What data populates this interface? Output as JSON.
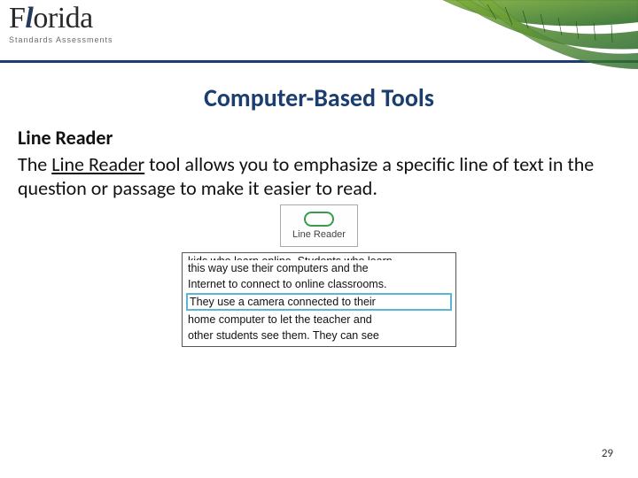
{
  "header": {
    "logo_main": "Florida",
    "logo_tagline": "Standards Assessments"
  },
  "title": "Computer-Based Tools",
  "content": {
    "subheading": "Line Reader",
    "para_pre": "The ",
    "para_tool": "Line Reader",
    "para_post": " tool allows you to emphasize a specific line of text in the question or passage to make it easier to read."
  },
  "tool_button": {
    "label": "Line Reader"
  },
  "passage": {
    "cutoff_top": "kids who learn online. Students who learn",
    "l1": "this way use their computers and the",
    "l2": "Internet to connect to online classrooms.",
    "highlight": "They use a camera connected to their",
    "l4": "home computer to let the teacher and",
    "l5": "other students see them. They can see"
  },
  "page_number": "29"
}
